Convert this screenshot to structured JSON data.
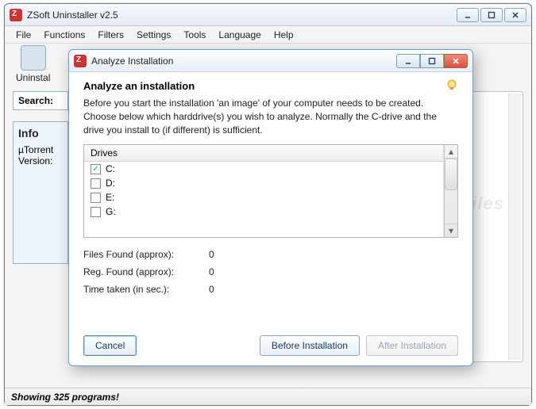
{
  "mainWindow": {
    "title": "ZSoft Uninstaller v2.5",
    "menu": [
      "File",
      "Functions",
      "Filters",
      "Settings",
      "Tools",
      "Language",
      "Help"
    ],
    "toolbar": {
      "uninstall": "Uninstal"
    },
    "search": {
      "label": "Search:"
    },
    "info": {
      "header": "Info",
      "line1": "µTorrent",
      "line2": "Version:"
    },
    "status": "Showing 325 programs!"
  },
  "dialog": {
    "title": "Analyze Installation",
    "heading": "Analyze an installation",
    "description": "Before you start the installation 'an image' of your computer needs to be created. Choose below which harddrive(s) you wish to analyze. Normally the C-drive and the drive you install to (if different) is sufficient.",
    "drivesHeader": "Drives",
    "drives": [
      {
        "label": "C:",
        "checked": true
      },
      {
        "label": "D:",
        "checked": false
      },
      {
        "label": "E:",
        "checked": false
      },
      {
        "label": "G:",
        "checked": false
      }
    ],
    "stats": {
      "filesLabel": "Files Found (approx):",
      "filesValue": "0",
      "regLabel": "Reg. Found (approx):",
      "regValue": "0",
      "timeLabel": "Time taken (in sec.):",
      "timeValue": "0"
    },
    "buttons": {
      "cancel": "Cancel",
      "before": "Before Installation",
      "after": "After Installation"
    }
  }
}
